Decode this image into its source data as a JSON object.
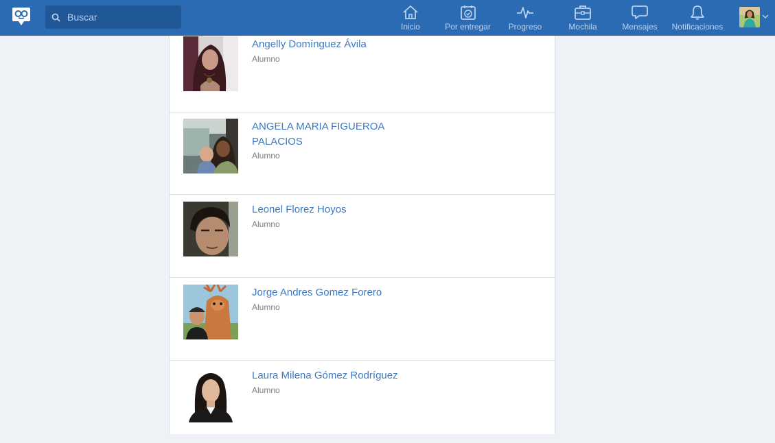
{
  "search": {
    "placeholder": "Buscar"
  },
  "nav": [
    {
      "label": "Inicio",
      "icon": "home-icon"
    },
    {
      "label": "Por entregar",
      "icon": "calendar-check-icon"
    },
    {
      "label": "Progreso",
      "icon": "pulse-icon"
    },
    {
      "label": "Mochila",
      "icon": "briefcase-icon"
    },
    {
      "label": "Mensajes",
      "icon": "chat-bubble-icon"
    },
    {
      "label": "Notificaciones",
      "icon": "bell-icon"
    }
  ],
  "colors": {
    "topbar": "#2b6bb3",
    "search_bg": "#1f5797",
    "link": "#3b7ac8",
    "page_bg": "#eef1f5"
  },
  "members": [
    {
      "name": "Angelly Domínguez Ávila",
      "role": "Alumno"
    },
    {
      "name": "ANGELA MARIA FIGUEROA PALACIOS",
      "role": "Alumno"
    },
    {
      "name": "Leonel Florez Hoyos",
      "role": "Alumno"
    },
    {
      "name": "Jorge Andres Gomez Forero",
      "role": "Alumno"
    },
    {
      "name": "Laura Milena Gómez Rodríguez",
      "role": "Alumno"
    }
  ]
}
